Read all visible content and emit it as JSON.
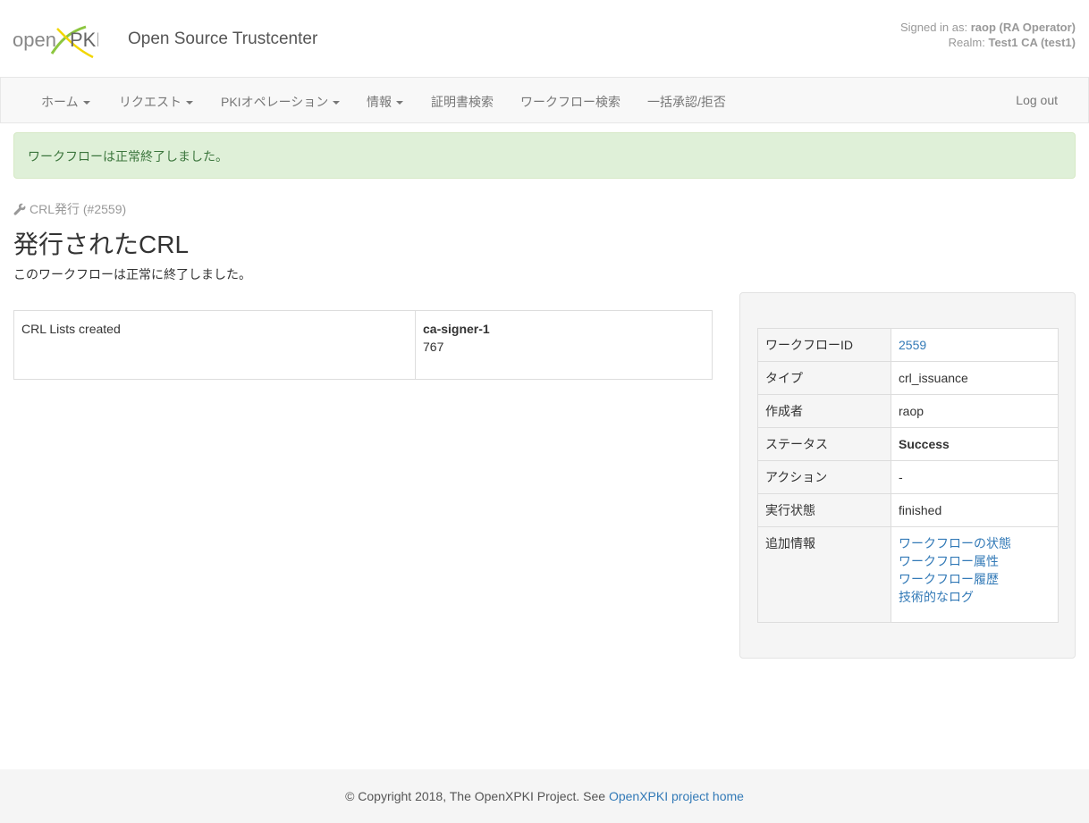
{
  "header": {
    "logo_text_open": "open",
    "logo_text_pki": "PKI",
    "site_title": "Open Source Trustcenter",
    "signed_in_label": "Signed in as:",
    "signed_in_user": "raop (RA Operator)",
    "realm_label": "Realm:",
    "realm_value": "Test1 CA (test1)"
  },
  "nav": {
    "items": [
      {
        "label": "ホーム"
      },
      {
        "label": "リクエスト"
      },
      {
        "label": "PKIオペレーション"
      },
      {
        "label": "情報"
      },
      {
        "label": "証明書検索"
      },
      {
        "label": "ワークフロー検索"
      },
      {
        "label": "一括承認/拒否"
      }
    ],
    "logout": "Log out"
  },
  "alert": "ワークフローは正常終了しました。",
  "breadcrumb": "CRL発行 (#2559)",
  "page_title": "発行されたCRL",
  "page_description": "このワークフローは正常に終了しました。",
  "crl_table": {
    "label": "CRL Lists created",
    "signer": "ca-signer-1",
    "count": "767"
  },
  "workflow_info": {
    "rows": [
      {
        "key": "ワークフローID",
        "value": "2559"
      },
      {
        "key": "タイプ",
        "value": "crl_issuance"
      },
      {
        "key": "作成者",
        "value": "raop"
      },
      {
        "key": "ステータス",
        "value": "Success"
      },
      {
        "key": "アクション",
        "value": "-"
      },
      {
        "key": "実行状態",
        "value": "finished"
      },
      {
        "key": "追加情報"
      }
    ],
    "extra_links": [
      "ワークフローの状態",
      "ワークフロー属性",
      "ワークフロー履歴",
      "技術的なログ"
    ]
  },
  "footer": {
    "text": "© Copyright 2018, The OpenXPKI Project. See ",
    "link": "OpenXPKI project home"
  },
  "colors": {
    "link": "#337ab7",
    "success_bg": "#dff0d8",
    "success_text": "#3c763d",
    "logo_green": "#8cc63f",
    "logo_yellow": "#f2d600"
  }
}
